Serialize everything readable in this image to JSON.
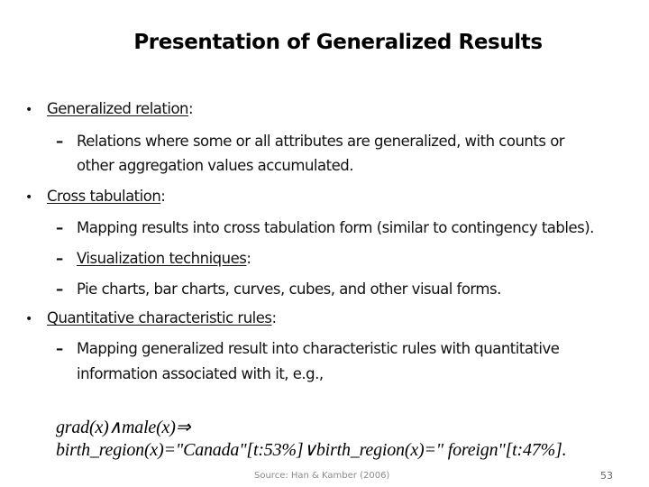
{
  "slide": {
    "title": "Presentation of Generalized Results",
    "bullets": [
      {
        "marker": "•",
        "term": "Generalized relation",
        "suffix": ":",
        "subitems": [
          {
            "marker": "–",
            "lines": [
              "Relations where some or all attributes are generalized, with counts or",
              "other aggregation values accumulated."
            ]
          }
        ]
      },
      {
        "marker": "•",
        "term": "Cross tabulation",
        "suffix": ":",
        "subitems": [
          {
            "marker": "–",
            "lines": [
              "Mapping results into cross tabulation form (similar to contingency tables)."
            ]
          },
          {
            "marker": "–",
            "term": "Visualization techniques",
            "suffix": ":"
          },
          {
            "marker": "–",
            "lines": [
              "Pie charts, bar charts, curves, cubes, and other visual forms."
            ]
          }
        ]
      },
      {
        "marker": "•",
        "term": "Quantitative characteristic rules",
        "suffix": ":",
        "subitems": [
          {
            "marker": "–",
            "lines": [
              "Mapping generalized result into characteristic rules with quantitative",
              "information associated with it, e.g.,"
            ]
          }
        ]
      }
    ],
    "formula": {
      "line1": "grad(x)∧male(x)⇒",
      "line2": "birth_region(x)=\"Canada\"[t:53%]∨birth_region(x)=\" foreign\"[t:47%]."
    },
    "footer": {
      "source": "Source: Han & Kamber (2006)",
      "page_number": "53"
    }
  }
}
